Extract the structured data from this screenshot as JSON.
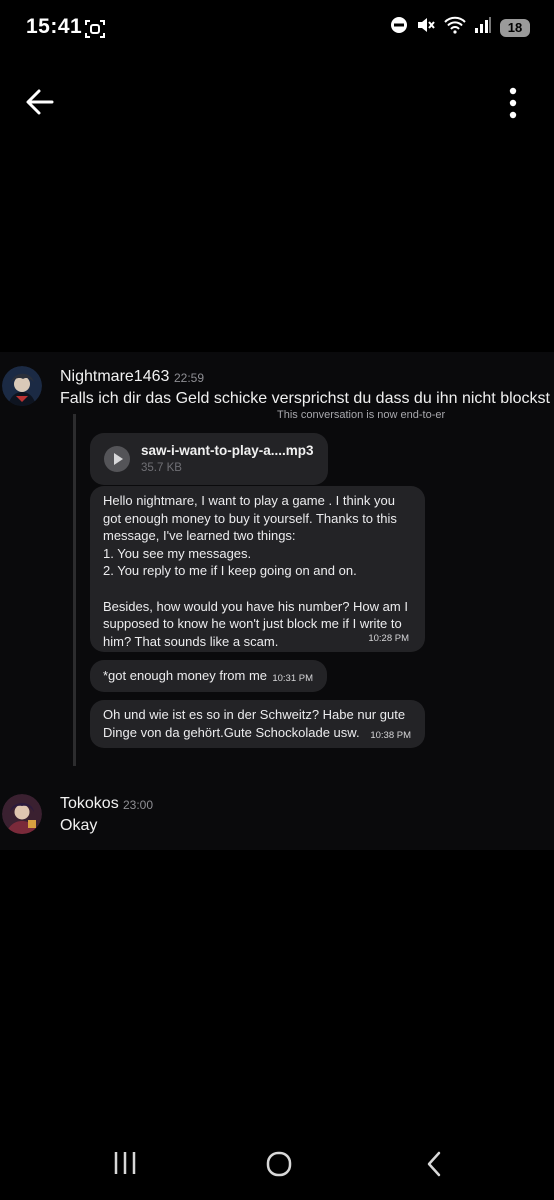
{
  "status_bar": {
    "time": "15:41",
    "battery_level": "18",
    "icons": [
      "screenshot-icon",
      "do-not-disturb-icon",
      "mute-icon",
      "wifi-icon",
      "signal-icon",
      "battery-icon"
    ]
  },
  "top_bar": {
    "back_icon": "arrow-left-icon",
    "more_icon": "more-vertical-icon"
  },
  "messages": [
    {
      "username": "Nightmare1463",
      "time": "22:59",
      "text": "Falls ich dir das Geld schicke versprichst du dass du ihn nicht blockst"
    },
    {
      "username": "Tokokos",
      "time": "23:00",
      "text": "Okay"
    }
  ],
  "embedded_screenshot": {
    "e2e_notice": "This conversation is now end-to-er",
    "audio": {
      "file_name": "saw-i-want-to-play-a....mp3",
      "file_size": "35.7 KB"
    },
    "bubbles": [
      {
        "text": "Hello nightmare, I want to play a game . I think you\ngot enough money to buy it yourself. Thanks to this\nmessage, I've learned two things:\n1. You see my messages.\n2. You reply to me if I keep going on and on.\n\nBesides, how would you have his number? How am I\nsupposed to know he won't just block me if I write to\nhim? That sounds like a scam.",
        "time": "10:28 PM"
      },
      {
        "text": "*got enough money from me",
        "time": "10:31 PM"
      },
      {
        "text": "Oh und wie ist es so in der Schweitz? Habe nur gute\nDinge von da gehört.Gute Schockolade usw.",
        "time": "10:38 PM"
      }
    ]
  },
  "nav_bar": {
    "icons": [
      "recents-icon",
      "home-icon",
      "back-icon"
    ]
  },
  "colors": {
    "background": "#000000",
    "chat_panel": "#0a0a0c",
    "bubble": "#232326",
    "timestamp": "#8e8e93"
  }
}
